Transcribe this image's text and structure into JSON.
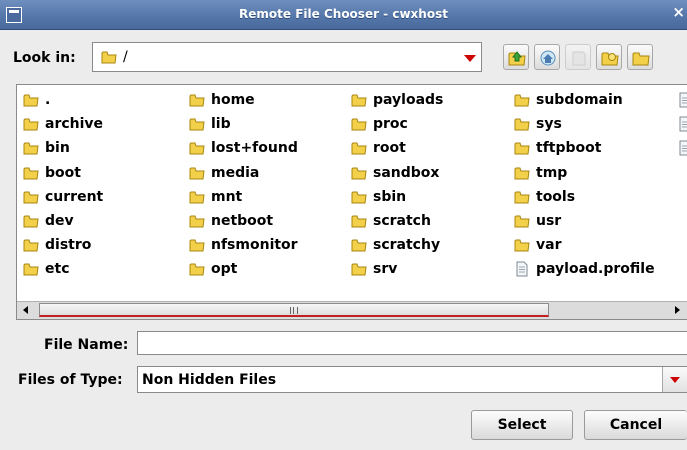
{
  "window": {
    "title": "Remote File Chooser - cwxhost",
    "close_glyph": "×"
  },
  "look_in": {
    "label": "Look in:",
    "value": "/"
  },
  "toolbar": {
    "buttons": [
      {
        "name": "up-folder-icon",
        "enabled": true
      },
      {
        "name": "home-icon",
        "enabled": true
      },
      {
        "name": "new-folder-icon",
        "enabled": false
      },
      {
        "name": "list-view-icon",
        "enabled": true
      },
      {
        "name": "details-view-icon",
        "enabled": true
      }
    ]
  },
  "files": {
    "columns": [
      [
        {
          "name": ".",
          "type": "folder"
        },
        {
          "name": "archive",
          "type": "folder"
        },
        {
          "name": "bin",
          "type": "folder"
        },
        {
          "name": "boot",
          "type": "folder"
        },
        {
          "name": "current",
          "type": "folder"
        },
        {
          "name": "dev",
          "type": "folder"
        },
        {
          "name": "distro",
          "type": "folder"
        },
        {
          "name": "etc",
          "type": "folder"
        }
      ],
      [
        {
          "name": "home",
          "type": "folder"
        },
        {
          "name": "lib",
          "type": "folder"
        },
        {
          "name": "lost+found",
          "type": "folder"
        },
        {
          "name": "media",
          "type": "folder"
        },
        {
          "name": "mnt",
          "type": "folder"
        },
        {
          "name": "netboot",
          "type": "folder"
        },
        {
          "name": "nfsmonitor",
          "type": "folder"
        },
        {
          "name": "opt",
          "type": "folder"
        }
      ],
      [
        {
          "name": "payloads",
          "type": "folder"
        },
        {
          "name": "proc",
          "type": "folder"
        },
        {
          "name": "root",
          "type": "folder"
        },
        {
          "name": "sandbox",
          "type": "folder"
        },
        {
          "name": "sbin",
          "type": "folder"
        },
        {
          "name": "scratch",
          "type": "folder"
        },
        {
          "name": "scratchy",
          "type": "folder"
        },
        {
          "name": "srv",
          "type": "folder"
        }
      ],
      [
        {
          "name": "subdomain",
          "type": "folder"
        },
        {
          "name": "sys",
          "type": "folder"
        },
        {
          "name": "tftpboot",
          "type": "folder"
        },
        {
          "name": "tmp",
          "type": "folder"
        },
        {
          "name": "tools",
          "type": "folder"
        },
        {
          "name": "usr",
          "type": "folder"
        },
        {
          "name": "var",
          "type": "folder"
        },
        {
          "name": "payload.profile",
          "type": "file"
        }
      ],
      [
        {
          "name": "",
          "type": "file"
        },
        {
          "name": "",
          "type": "file"
        },
        {
          "name": "",
          "type": "file"
        }
      ]
    ]
  },
  "file_name": {
    "label": "File Name:",
    "value": "",
    "placeholder": ""
  },
  "file_type": {
    "label": "Files of Type:",
    "value": "Non Hidden Files"
  },
  "buttons": {
    "select": "Select",
    "cancel": "Cancel"
  },
  "colors": {
    "folder": "#e8c233",
    "arrow": "#cc0000",
    "titlebar": "#5577aa"
  }
}
